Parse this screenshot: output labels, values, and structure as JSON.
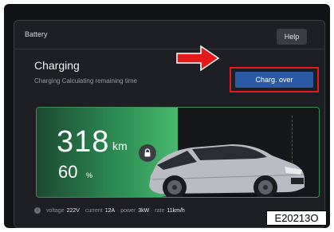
{
  "header": {
    "title": "Battery",
    "help_label": "Help"
  },
  "status": {
    "title": "Charging",
    "subtitle": "Charging Calculating remaining time",
    "button_label": "Charg. over"
  },
  "battery": {
    "range_value": "318",
    "range_unit": "km",
    "soc_value": "60",
    "soc_unit": "%",
    "fill_fraction": 0.5
  },
  "info": [
    {
      "label": "voltage",
      "value": "222V"
    },
    {
      "label": "current",
      "value": "12A"
    },
    {
      "label": "power",
      "value": "3kW"
    },
    {
      "label": "rate",
      "value": "11km/h"
    }
  ],
  "reference_code": "E20213O",
  "colors": {
    "accent": "#2d5aa6",
    "battery_green": "#47ba6d",
    "highlight_red": "#e3191c"
  },
  "icons": [
    "arrow-icon",
    "lock-icon",
    "info-icon"
  ]
}
